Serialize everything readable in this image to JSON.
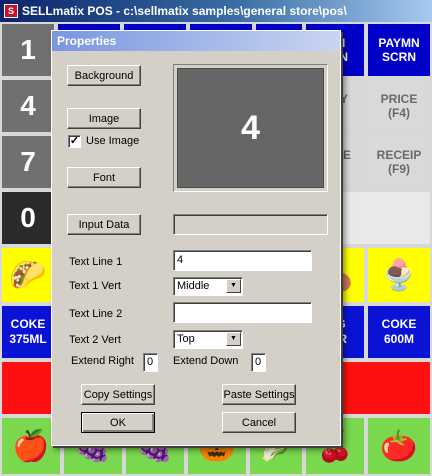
{
  "window": {
    "title": "SELLmatix POS - c:\\sellmatix samples\\general store\\pos\\"
  },
  "grid": {
    "numbers": [
      "1",
      "4",
      "7",
      "0"
    ],
    "top_right": [
      {
        "line1": "AIN",
        "line2": "CRN"
      },
      {
        "line1": "PAYMN",
        "line2": "SCRN"
      }
    ],
    "mid_right": [
      {
        "line1": "TITY",
        "line2": "3)"
      },
      {
        "line1": "PRICE",
        "line2": "(F4)"
      },
      {
        "line1": "SALE",
        "line2": "8)"
      },
      {
        "line1": "RECEIP",
        "line2": "(F9)"
      }
    ],
    "drinks": [
      {
        "line1": "COKE",
        "line2": "375ML"
      },
      {
        "line1": "ING",
        "line2": "TER"
      },
      {
        "line1": "COKE",
        "line2": "600M"
      }
    ]
  },
  "dialog": {
    "title": "Properties",
    "background_button": "Background",
    "image_button": "Image",
    "use_image_label": "Use Image",
    "use_image_checked": true,
    "font_button": "Font",
    "preview_text": "4",
    "input_data_button": "Input Data",
    "input_data_value": "",
    "text_line1_label": "Text Line 1",
    "text_line1_value": "4",
    "text1_vert_label": "Text 1 Vert",
    "text1_vert_value": "Middle",
    "text_line2_label": "Text Line 2",
    "text_line2_value": "",
    "text2_vert_label": "Text 2 Vert",
    "text2_vert_value": "Top",
    "extend_right_label": "Extend Right",
    "extend_right_value": "0",
    "extend_down_label": "Extend Down",
    "extend_down_value": "0",
    "copy_settings": "Copy Settings",
    "paste_settings": "Paste Settings",
    "ok": "OK",
    "cancel": "Cancel"
  }
}
